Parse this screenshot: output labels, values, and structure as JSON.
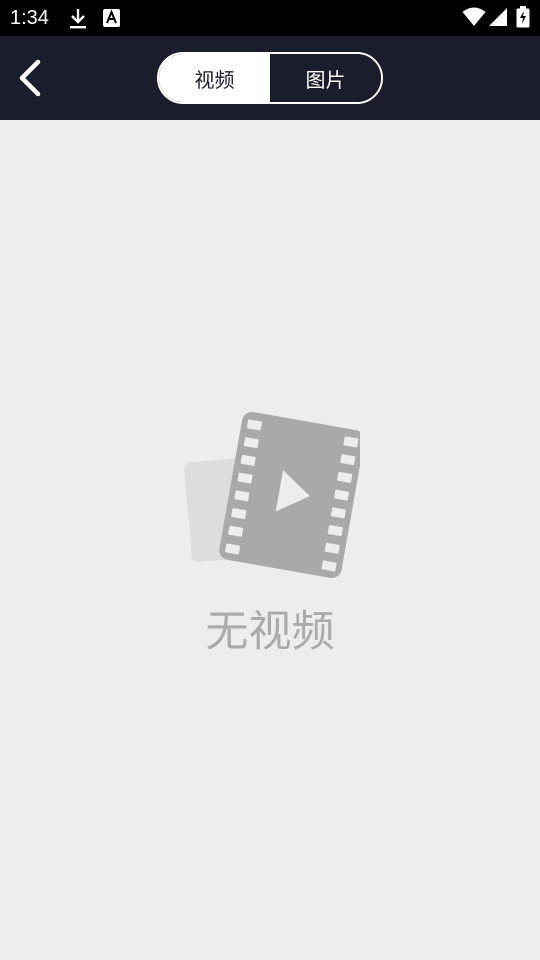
{
  "status_bar": {
    "time": "1:34",
    "icons": [
      "download-icon",
      "a-icon",
      "wifi-icon",
      "signal-icon",
      "battery-charging-icon"
    ]
  },
  "header": {
    "back_icon": "chevron-left-icon",
    "tabs": [
      {
        "label": "视频",
        "selected": true
      },
      {
        "label": "图片",
        "selected": false
      }
    ]
  },
  "empty_state": {
    "icon": "video-film-icon",
    "message": "无视频"
  },
  "colors": {
    "header_bg": "#1a1d2b",
    "page_bg": "#ededed",
    "status_bg": "#000000",
    "empty_text": "#aaaaaa"
  }
}
